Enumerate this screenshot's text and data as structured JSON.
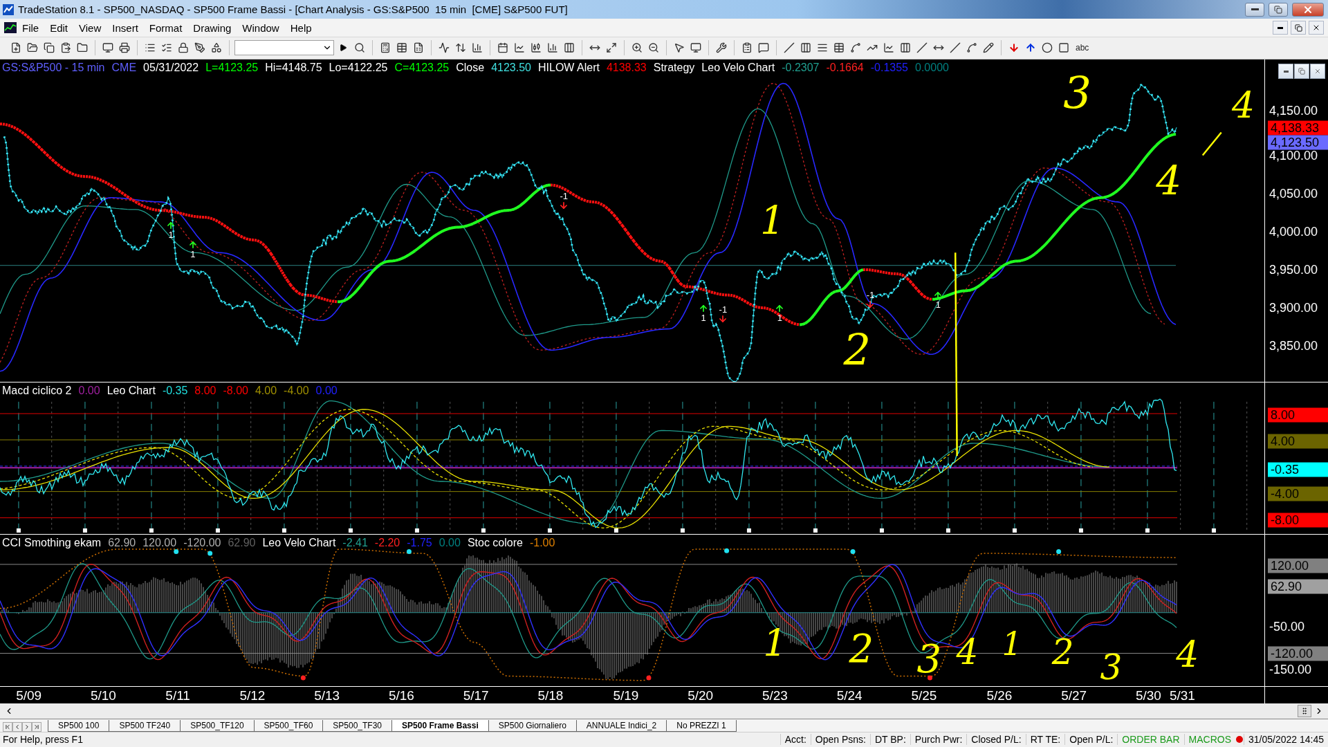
{
  "window": {
    "title": "TradeStation 8.1 - SP500_NASDAQ - SP500 Frame Bassi - [Chart Analysis - GS:S&P500  15 min  [CME] S&P500 FUT]"
  },
  "menu": [
    "File",
    "Edit",
    "View",
    "Insert",
    "Format",
    "Drawing",
    "Window",
    "Help"
  ],
  "toolbar": {
    "text_tool": "abc"
  },
  "panels": [
    {
      "kind": "price",
      "legend": [
        {
          "text": "GS:S&P500 - 15 min",
          "color": "#5f5fff"
        },
        {
          "text": "CME",
          "color": "#5f5fff"
        },
        {
          "text": "05/31/2022",
          "color": "#ffffff"
        },
        {
          "text": "L=4123.25",
          "color": "#00ff00"
        },
        {
          "text": "Hi=4148.75",
          "color": "#ffffff"
        },
        {
          "text": "Lo=4122.25",
          "color": "#ffffff"
        },
        {
          "text": "C=4123.25",
          "color": "#00ff00"
        },
        {
          "text": "Close",
          "color": "#ffffff"
        },
        {
          "text": "4123.50",
          "color": "#40e0e0"
        },
        {
          "text": "HILOW Alert",
          "color": "#ffffff"
        },
        {
          "text": "4138.33",
          "color": "#ff0000"
        },
        {
          "text": "Strategy",
          "color": "#ffffff"
        },
        {
          "text": "Leo Velo Chart",
          "color": "#ffffff"
        },
        {
          "text": "-0.2307",
          "color": "#20a090"
        },
        {
          "text": "-0.1664",
          "color": "#ff2020"
        },
        {
          "text": "-0.1355",
          "color": "#2020ff"
        },
        {
          "text": "0.0000",
          "color": "#008080"
        }
      ],
      "ticks": [
        "4,150.00",
        "4,100.00",
        "4,050.00",
        "4,000.00",
        "3,950.00",
        "3,900.00",
        "3,850.00"
      ],
      "badges": [
        {
          "text": "4,138.33",
          "color": "#ff0000"
        },
        {
          "text": "4,123.50",
          "color": "#6a6aff"
        }
      ]
    },
    {
      "kind": "macd",
      "legend": [
        {
          "text": "Macd ciclico 2",
          "color": "#ffffff"
        },
        {
          "text": "0.00",
          "color": "#a020a0"
        },
        {
          "text": "Leo Chart",
          "color": "#ffffff"
        },
        {
          "text": "-0.35",
          "color": "#20e0e0"
        },
        {
          "text": "8.00",
          "color": "#ff0000"
        },
        {
          "text": "-8.00",
          "color": "#ff0000"
        },
        {
          "text": "4.00",
          "color": "#a09000"
        },
        {
          "text": "-4.00",
          "color": "#a09000"
        },
        {
          "text": "0.00",
          "color": "#2020ff"
        }
      ],
      "badges": [
        {
          "text": "8.00",
          "color": "#ff0000"
        },
        {
          "text": "4.00",
          "color": "#6b6400"
        },
        {
          "text": "-0.35",
          "color": "#00ffff"
        },
        {
          "text": "-4.00",
          "color": "#6b6400"
        },
        {
          "text": "-8.00",
          "color": "#ff0000"
        }
      ]
    },
    {
      "kind": "cci",
      "legend": [
        {
          "text": "CCI Smothing ekam",
          "color": "#ffffff"
        },
        {
          "text": "62.90",
          "color": "#b0b0b0"
        },
        {
          "text": "120.00",
          "color": "#b0b0b0"
        },
        {
          "text": "-120.00",
          "color": "#b0b0b0"
        },
        {
          "text": "62.90",
          "color": "#606060"
        },
        {
          "text": "Leo Velo Chart",
          "color": "#ffffff"
        },
        {
          "text": "-2.41",
          "color": "#20a090"
        },
        {
          "text": "-2.20",
          "color": "#ff2020"
        },
        {
          "text": "-1.75",
          "color": "#2020ff"
        },
        {
          "text": "0.00",
          "color": "#008080"
        },
        {
          "text": "Stoc colore",
          "color": "#ffffff"
        },
        {
          "text": "-1.00",
          "color": "#e08000"
        }
      ],
      "ticks": [
        "-50.00",
        "-150.00"
      ],
      "badges": [
        {
          "text": "120.00",
          "color": "#808080"
        },
        {
          "text": "62.90",
          "color": "#a0a0a0"
        },
        {
          "text": "-120.00",
          "color": "#808080"
        }
      ]
    }
  ],
  "signals": [
    {
      "text": "1",
      "kind": "buy"
    },
    {
      "text": "1",
      "kind": "buy"
    },
    {
      "text": "-1",
      "kind": "sell"
    },
    {
      "text": "1",
      "kind": "buy"
    },
    {
      "text": "-1",
      "kind": "sell"
    },
    {
      "text": "1",
      "kind": "buy"
    },
    {
      "text": "-1",
      "kind": "sell"
    },
    {
      "text": "1",
      "kind": "buy"
    }
  ],
  "annotations": [
    "3",
    "4",
    "1",
    "4",
    "2",
    "1",
    "2",
    "3",
    "4",
    "1",
    "2",
    "3",
    "4"
  ],
  "dates": [
    "5/09",
    "5/10",
    "5/11",
    "5/12",
    "5/13",
    "5/16",
    "5/17",
    "5/18",
    "5/19",
    "5/20",
    "5/23",
    "5/24",
    "5/25",
    "5/26",
    "5/27",
    "5/30",
    "5/31"
  ],
  "tabs": [
    {
      "label": "SP500 100",
      "selected": false
    },
    {
      "label": "SP500 TF240",
      "selected": false
    },
    {
      "label": "SP500_TF120",
      "selected": false
    },
    {
      "label": "SP500_TF60",
      "selected": false
    },
    {
      "label": "SP500_TF30",
      "selected": false
    },
    {
      "label": "SP500 Frame Bassi",
      "selected": true
    },
    {
      "label": "SP500 Giornaliero",
      "selected": false
    },
    {
      "label": "ANNUALE Indici_2",
      "selected": false
    },
    {
      "label": "No PREZZI 1",
      "selected": false
    }
  ],
  "status_bar": {
    "help": "For Help, press F1",
    "fields": [
      "Acct:",
      "Open Psns:",
      "DT BP:",
      "Purch Pwr:",
      "Closed P/L:",
      "RT TE:",
      "Open P/L:"
    ],
    "order_bar": "ORDER BAR",
    "macros": "MACROS",
    "datetime": "31/05/2022 14:45"
  }
}
